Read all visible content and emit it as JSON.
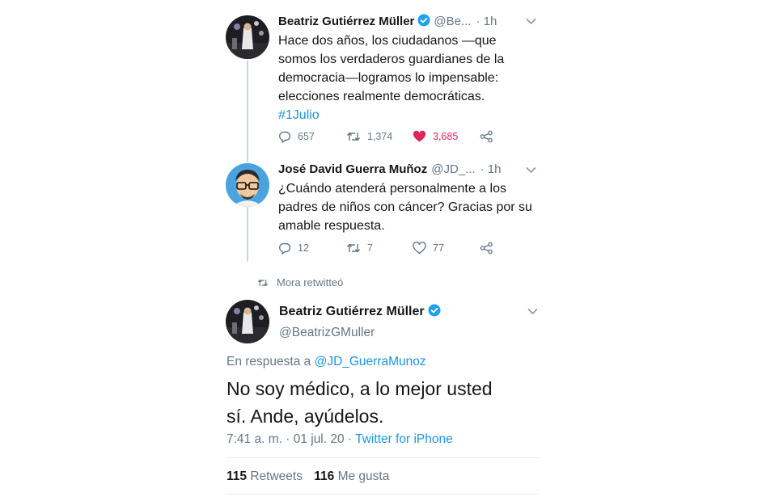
{
  "thread": [
    {
      "author": "Beatriz Gutiérrez Müller",
      "handle": "@Be...",
      "time": "· 1h",
      "text": "Hace dos años, los ciudadanos —que somos los verdaderos guardianes de la democracia—logramos lo impensable: elecciones realmente democráticas.",
      "hashtag": "#1Julio",
      "replies": "657",
      "retweets": "1,374",
      "likes": "3,685",
      "liked": true
    },
    {
      "author": "José David Guerra Muñoz",
      "handle": "@JD_...",
      "time": "· 1h",
      "text": "¿Cuándo atenderá personalmente a los padres de niños con cáncer? Gracias por su amable respuesta.",
      "replies": "12",
      "retweets": "7",
      "likes": "77",
      "liked": false
    }
  ],
  "retweet_notice": "Mora retwitteó",
  "main_tweet": {
    "author": "Beatriz Gutiérrez Müller",
    "handle": "@BeatrizGMuller",
    "reply_prefix": "En respuesta a",
    "reply_to": "@JD_GuerraMunoz",
    "text_line1": "No soy médico, a lo mejor usted",
    "text_line2": "sí. Ande, ayúdelos.",
    "timestamp": "7:41 a. m. · 01 jul. 20 ·",
    "client": "Twitter for iPhone",
    "retweets_count": "115",
    "retweets_label": "Retweets",
    "likes_count": "116",
    "likes_label": "Me gusta"
  },
  "colors": {
    "link": "#1b95e0",
    "like_active": "#e0245e",
    "muted": "#657786",
    "verified": "#1da1f2"
  },
  "icons": [
    "verified-badge-icon",
    "chevron-down-icon",
    "reply-icon",
    "retweet-icon",
    "heart-icon",
    "share-icon"
  ]
}
